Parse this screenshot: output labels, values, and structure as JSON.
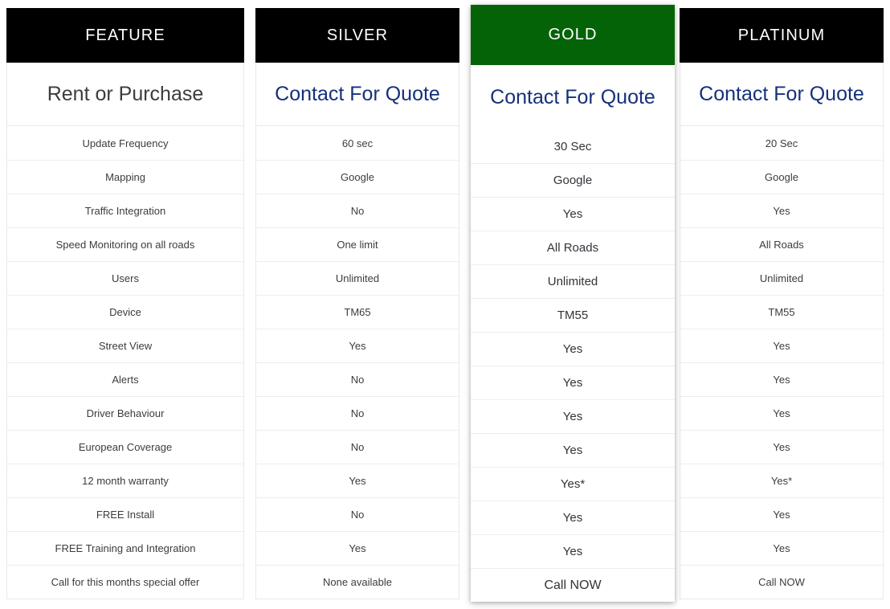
{
  "table": {
    "columns": [
      {
        "key": "feature",
        "header": "FEATURE",
        "header_bg": "#000000",
        "header_color": "#ffffff",
        "quote": "Rent or Purchase",
        "quote_color": "#3c3c3c",
        "featured": false,
        "values": [
          "Update Frequency",
          "Mapping",
          "Traffic Integration",
          "Speed Monitoring on all roads",
          "Users",
          "Device",
          "Street View",
          "Alerts",
          "Driver Behaviour",
          "European Coverage",
          "12 month warranty",
          "FREE Install",
          "FREE Training and Integration",
          "Call for this months special offer"
        ]
      },
      {
        "key": "silver",
        "header": "SILVER",
        "header_bg": "#000000",
        "header_color": "#ffffff",
        "quote": "Contact For Quote",
        "quote_color": "#16307a",
        "featured": false,
        "values": [
          "60 sec",
          "Google",
          "No",
          "One limit",
          "Unlimited",
          "TM65",
          "Yes",
          "No",
          "No",
          "No",
          "Yes",
          "No",
          "Yes",
          "None available"
        ]
      },
      {
        "key": "gold",
        "header": "GOLD",
        "header_bg": "#046307",
        "header_color": "#ffffff",
        "quote": "Contact For Quote",
        "quote_color": "#16307a",
        "featured": true,
        "values": [
          "30 Sec",
          "Google",
          "Yes",
          "All Roads",
          "Unlimited",
          "TM55",
          "Yes",
          "Yes",
          "Yes",
          "Yes",
          "Yes*",
          "Yes",
          "Yes",
          "Call NOW"
        ]
      },
      {
        "key": "platinum",
        "header": "PLATINUM",
        "header_bg": "#000000",
        "header_color": "#ffffff",
        "quote": "Contact For Quote",
        "quote_color": "#16307a",
        "featured": false,
        "values": [
          "20 Sec",
          "Google",
          "Yes",
          "All Roads",
          "Unlimited",
          "TM55",
          "Yes",
          "Yes",
          "Yes",
          "Yes",
          "Yes*",
          "Yes",
          "Yes",
          "Call NOW"
        ]
      }
    ]
  }
}
